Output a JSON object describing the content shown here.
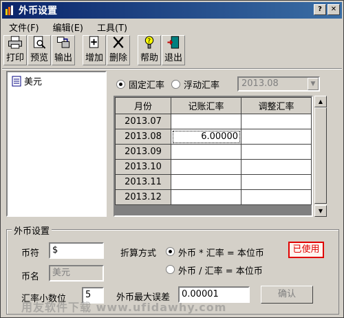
{
  "window": {
    "title": "外币设置"
  },
  "menu": {
    "items": [
      "文件(F)",
      "编辑(E)",
      "工具(T)"
    ]
  },
  "toolbar": {
    "print": "打印",
    "preview": "预览",
    "output": "输出",
    "add": "增加",
    "delete": "删除",
    "help": "帮助",
    "exit": "退出"
  },
  "tree": {
    "items": [
      "美元"
    ]
  },
  "rate_mode": {
    "fixed": "固定汇率",
    "floating": "浮动汇率",
    "selected": "fixed",
    "period": "2013.08"
  },
  "grid": {
    "headers": [
      "月份",
      "记账汇率",
      "调整汇率"
    ],
    "rows": [
      {
        "month": "2013.07",
        "rate": "",
        "adjust": ""
      },
      {
        "month": "2013.08",
        "rate": "6.00000",
        "adjust": ""
      },
      {
        "month": "2013.09",
        "rate": "",
        "adjust": ""
      },
      {
        "month": "2013.10",
        "rate": "",
        "adjust": ""
      },
      {
        "month": "2013.11",
        "rate": "",
        "adjust": ""
      },
      {
        "month": "2013.12",
        "rate": "",
        "adjust": ""
      }
    ]
  },
  "settings": {
    "legend": "外币设置",
    "symbol_label": "币符",
    "symbol_value": "$",
    "name_label": "币名",
    "name_value": "美元",
    "decimals_label": "汇率小数位",
    "decimals_value": "5",
    "method_label": "折算方式",
    "method_opt1": "外币 * 汇率 = 本位币",
    "method_opt2": "外币 / 汇率 = 本位币",
    "used_badge": "已使用",
    "max_error_label": "外币最大误差",
    "max_error_value": "0.00001",
    "confirm": "确认"
  },
  "watermark": "用友软件下载 www.ufidawhy.com",
  "colors": {
    "titlebar": "#0a246a",
    "badge": "#e00000",
    "face": "#d4d0c8"
  }
}
